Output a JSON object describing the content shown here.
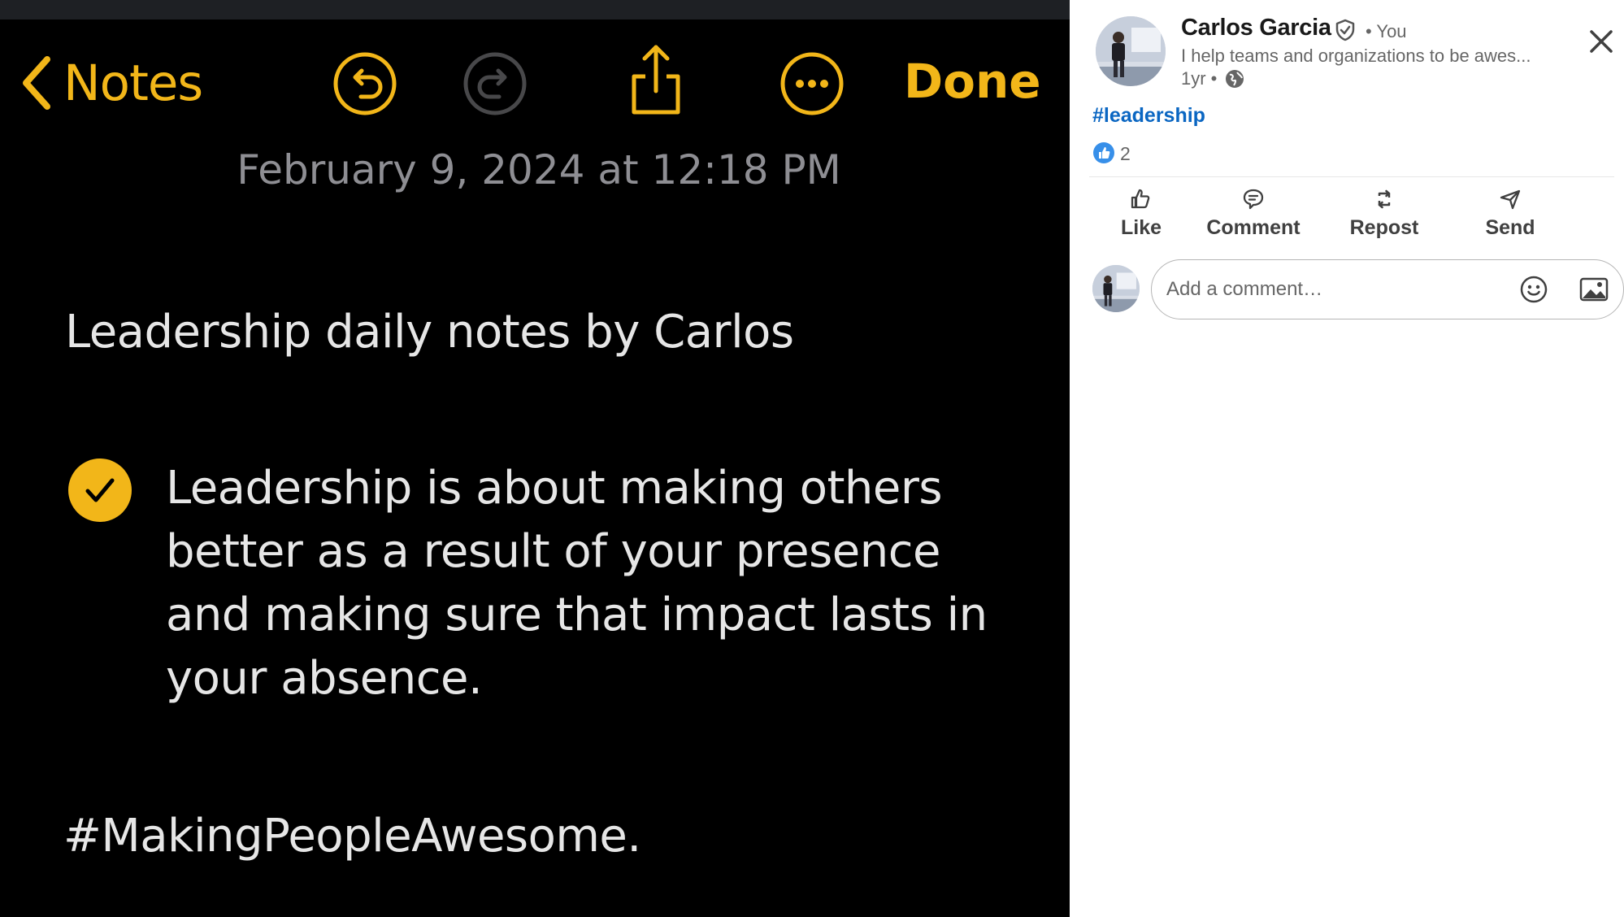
{
  "notes_app": {
    "back_label": "Notes",
    "done_label": "Done",
    "date_time": "February 9, 2024 at 12:18 PM",
    "title": "Leadership daily notes by Carlos",
    "checklist_item": "Leadership is about making others better as a result of your presence and making sure that impact lasts in your absence.",
    "checklist_checked": true,
    "hashtag": "#MakingPeopleAwesome.",
    "accent_color": "#f2b619",
    "icons": [
      "chevron-left-icon",
      "undo-icon",
      "redo-icon",
      "share-icon",
      "more-icon",
      "checkmark-icon"
    ]
  },
  "post": {
    "author_name": "Carlos Garcia",
    "you_label": "• You",
    "headline": "I help teams and organizations to be awes...",
    "time": "1yr •",
    "hashtag": "#leadership",
    "reaction_count": "2",
    "actions": [
      {
        "label": "Like",
        "icon": "like-icon"
      },
      {
        "label": "Comment",
        "icon": "comment-icon"
      },
      {
        "label": "Repost",
        "icon": "repost-icon"
      },
      {
        "label": "Send",
        "icon": "send-icon"
      }
    ],
    "comment_placeholder": "Add a comment…",
    "link_color": "#0a66c2"
  }
}
